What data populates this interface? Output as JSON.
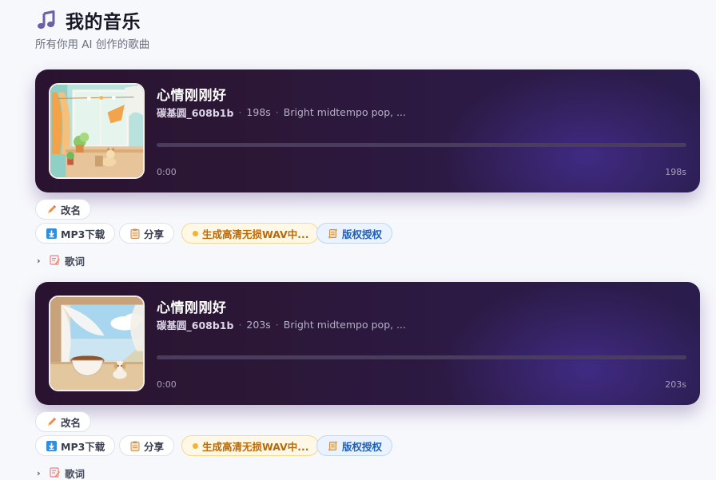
{
  "header": {
    "icon": "music-note-icon",
    "title": "我的音乐",
    "subtitle": "所有你用 AI 创作的歌曲"
  },
  "colors": {
    "player_bg_start": "#2a1330",
    "player_bg_end": "#2a1c4c",
    "wav_accent": "#b86a08",
    "license_accent": "#1f5fb6"
  },
  "songs": [
    {
      "title": "心情刚刚好",
      "author": "碳基圆_608b1b",
      "duration": "198s",
      "description": "Bright midtempo pop, ...",
      "time_start": "0:00",
      "time_end": "198s",
      "progress": 0,
      "cover_icon": "window-cat-balcony-illustration",
      "actions": {
        "rename": "改名",
        "mp3": "MP3下载",
        "share": "分享",
        "wav": "生成高清无损WAV中...",
        "license": "版权授权"
      },
      "lyrics_label": "歌词"
    },
    {
      "title": "心情刚刚好",
      "author": "碳基圆_608b1b",
      "duration": "203s",
      "description": "Bright midtempo pop, ...",
      "time_start": "0:00",
      "time_end": "203s",
      "progress": 0,
      "cover_icon": "window-puppy-bowl-illustration",
      "actions": {
        "rename": "改名",
        "mp3": "MP3下载",
        "share": "分享",
        "wav": "生成高清无损WAV中...",
        "license": "版权授权"
      },
      "lyrics_label": "歌词"
    }
  ]
}
